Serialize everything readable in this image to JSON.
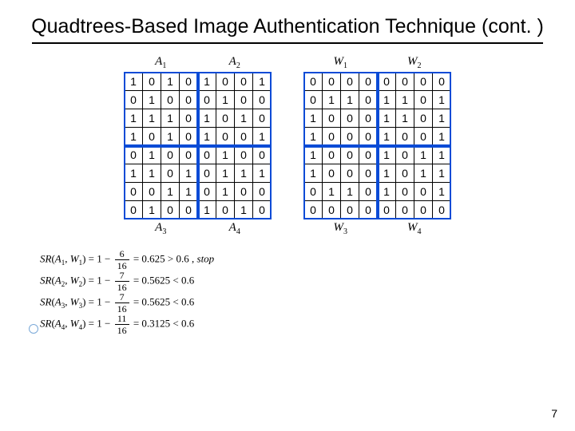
{
  "title": "Quadtrees-Based Image Authentication Technique (cont. )",
  "page_number": "7",
  "labels": {
    "A1": "A",
    "A1s": "1",
    "A2": "A",
    "A2s": "2",
    "A3": "A",
    "A3s": "3",
    "A4": "A",
    "A4s": "4",
    "W1": "W",
    "W1s": "1",
    "W2": "W",
    "W2s": "2",
    "W3": "W",
    "W3s": "3",
    "W4": "W",
    "W4s": "4"
  },
  "matrixA": [
    [
      1,
      0,
      1,
      0,
      1,
      0,
      0,
      1
    ],
    [
      0,
      1,
      0,
      0,
      0,
      1,
      0,
      0
    ],
    [
      1,
      1,
      1,
      0,
      1,
      0,
      1,
      0
    ],
    [
      1,
      0,
      1,
      0,
      1,
      0,
      0,
      1
    ],
    [
      0,
      1,
      0,
      0,
      0,
      1,
      0,
      0
    ],
    [
      1,
      1,
      0,
      1,
      0,
      1,
      1,
      1
    ],
    [
      0,
      0,
      1,
      1,
      0,
      1,
      0,
      0
    ],
    [
      0,
      1,
      0,
      0,
      1,
      0,
      1,
      0
    ]
  ],
  "matrixW": [
    [
      0,
      0,
      0,
      0,
      0,
      0,
      0,
      0
    ],
    [
      0,
      1,
      1,
      0,
      1,
      1,
      0,
      1
    ],
    [
      1,
      0,
      0,
      0,
      1,
      1,
      0,
      1
    ],
    [
      1,
      0,
      0,
      0,
      1,
      0,
      0,
      1
    ],
    [
      1,
      0,
      0,
      0,
      1,
      0,
      1,
      1
    ],
    [
      1,
      0,
      0,
      0,
      1,
      0,
      1,
      1
    ],
    [
      0,
      1,
      1,
      0,
      1,
      0,
      0,
      1
    ],
    [
      0,
      0,
      0,
      0,
      0,
      0,
      0,
      0
    ]
  ],
  "formulas": [
    {
      "lhs_letter": "A",
      "lhs_sub": "1",
      "rhs_letter": "W",
      "rhs_sub": "1",
      "num": "6",
      "den": "16",
      "val": "0.625",
      "cmp": "> 0.6 ,",
      "tail": "stop"
    },
    {
      "lhs_letter": "A",
      "lhs_sub": "2",
      "rhs_letter": "W",
      "rhs_sub": "2",
      "num": "7",
      "den": "16",
      "val": "0.5625",
      "cmp": "< 0.6",
      "tail": ""
    },
    {
      "lhs_letter": "A",
      "lhs_sub": "3",
      "rhs_letter": "W",
      "rhs_sub": "3",
      "num": "7",
      "den": "16",
      "val": "0.5625",
      "cmp": "< 0.6",
      "tail": ""
    },
    {
      "lhs_letter": "A",
      "lhs_sub": "4",
      "rhs_letter": "W",
      "rhs_sub": "4",
      "num": "11",
      "den": "16",
      "val": "0.3125",
      "cmp": "< 0.6",
      "tail": ""
    }
  ],
  "chart_data": {
    "type": "table",
    "title": "Quadtrees-Based Image Authentication Technique (cont.)",
    "note": "Two 8x8 binary matrices A and W each split into four 4x4 quadrants, plus similarity-ratio formulas",
    "A": {
      "A1": [
        [
          1,
          0,
          1,
          0
        ],
        [
          0,
          1,
          0,
          0
        ],
        [
          1,
          1,
          1,
          0
        ],
        [
          1,
          0,
          1,
          0
        ]
      ],
      "A2": [
        [
          1,
          0,
          0,
          1
        ],
        [
          0,
          1,
          0,
          0
        ],
        [
          1,
          0,
          1,
          0
        ],
        [
          1,
          0,
          0,
          1
        ]
      ],
      "A3": [
        [
          0,
          1,
          0,
          0
        ],
        [
          1,
          1,
          0,
          1
        ],
        [
          0,
          0,
          1,
          1
        ],
        [
          0,
          1,
          0,
          0
        ]
      ],
      "A4": [
        [
          0,
          1,
          0,
          0
        ],
        [
          0,
          1,
          1,
          1
        ],
        [
          0,
          1,
          0,
          0
        ],
        [
          1,
          0,
          1,
          0
        ]
      ]
    },
    "W": {
      "W1": [
        [
          0,
          0,
          0,
          0
        ],
        [
          0,
          1,
          1,
          0
        ],
        [
          1,
          0,
          0,
          0
        ],
        [
          1,
          0,
          0,
          0
        ]
      ],
      "W2": [
        [
          0,
          0,
          0,
          0
        ],
        [
          1,
          1,
          0,
          1
        ],
        [
          1,
          1,
          0,
          1
        ],
        [
          1,
          0,
          0,
          1
        ]
      ],
      "W3": [
        [
          1,
          0,
          0,
          0
        ],
        [
          1,
          0,
          0,
          0
        ],
        [
          0,
          1,
          1,
          0
        ],
        [
          0,
          0,
          0,
          0
        ]
      ],
      "W4": [
        [
          1,
          0,
          1,
          1
        ],
        [
          1,
          0,
          1,
          1
        ],
        [
          1,
          0,
          0,
          1
        ],
        [
          0,
          0,
          0,
          0
        ]
      ]
    },
    "SR": [
      {
        "pair": "A1,W1",
        "expr": "1 - 6/16",
        "value": 0.625,
        "relation": "> 0.6",
        "action": "stop"
      },
      {
        "pair": "A2,W2",
        "expr": "1 - 7/16",
        "value": 0.5625,
        "relation": "< 0.6"
      },
      {
        "pair": "A3,W3",
        "expr": "1 - 7/16",
        "value": 0.5625,
        "relation": "< 0.6"
      },
      {
        "pair": "A4,W4",
        "expr": "1 - 11/16",
        "value": 0.3125,
        "relation": "< 0.6"
      }
    ]
  }
}
